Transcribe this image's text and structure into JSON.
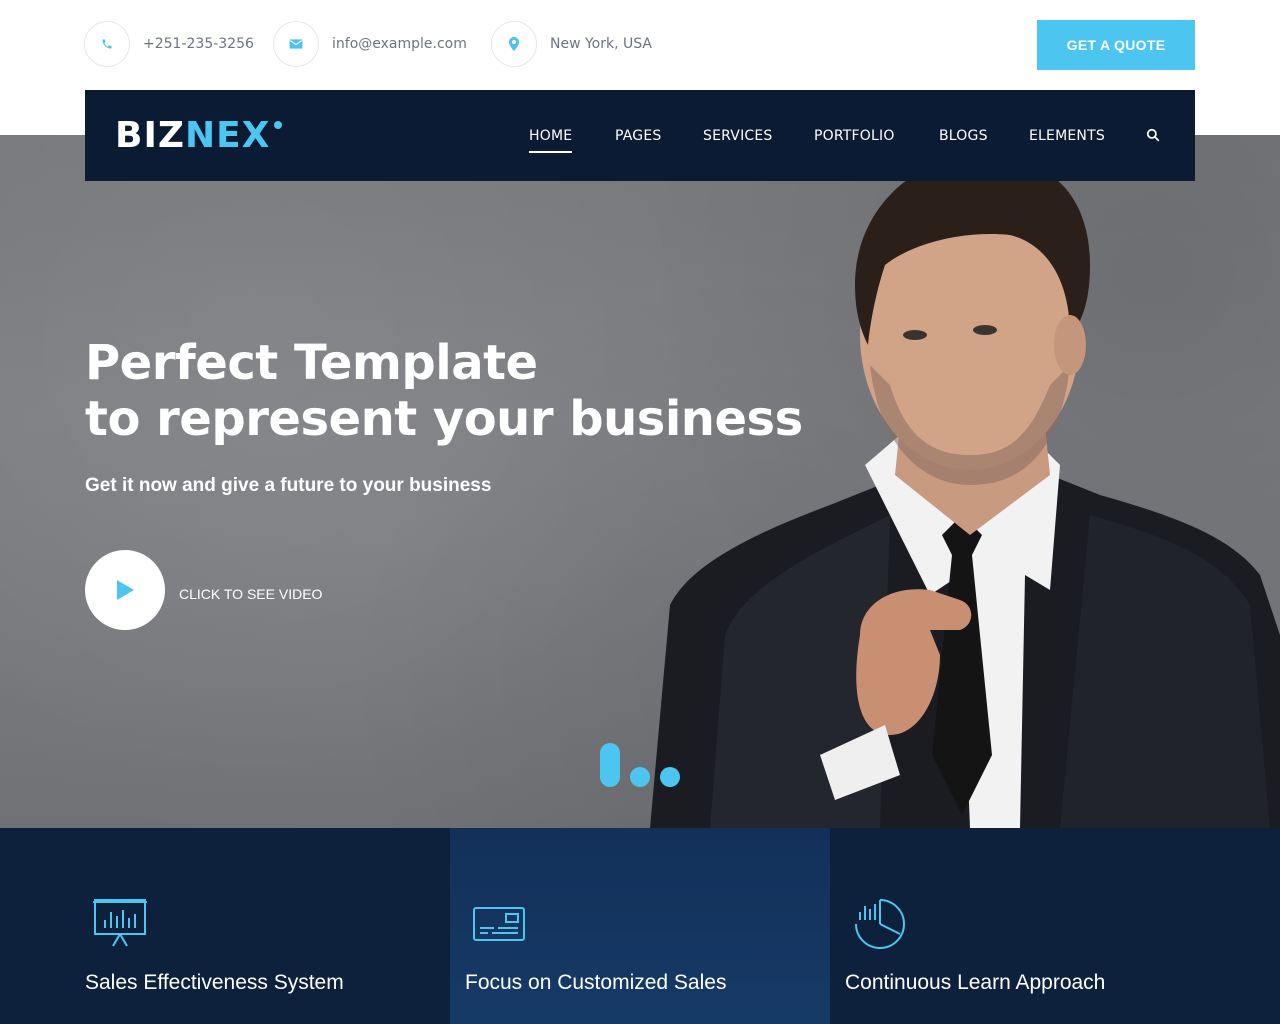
{
  "topbar": {
    "phone": "+251-235-3256",
    "email": "info@example.com",
    "location": "New York, USA",
    "quote_label": "GET A QUOTE"
  },
  "nav": {
    "logo_part1": "BIZ",
    "logo_part2": "NEX",
    "items": [
      {
        "label": "HOME",
        "active": true
      },
      {
        "label": "PAGES"
      },
      {
        "label": "SERVICES"
      },
      {
        "label": "PORTFOLIO"
      },
      {
        "label": "BLOGS"
      },
      {
        "label": "ELEMENTS"
      }
    ],
    "search_icon": "search-icon"
  },
  "hero": {
    "title_line1": "Perfect Template",
    "title_line2": "to represent your business",
    "subtitle": "Get it now and give a future to your business",
    "video_label": "CLICK TO SEE VIDEO",
    "slides": 3,
    "active_slide": 1
  },
  "features": [
    {
      "title": "Sales Effectiveness System",
      "icon": "presentation-chart-icon"
    },
    {
      "title": "Focus on Customized Sales",
      "icon": "credit-card-icon"
    },
    {
      "title": "Continuous Learn Approach",
      "icon": "pie-chart-icon"
    }
  ],
  "colors": {
    "accent": "#4cc6f1",
    "navy": "#0c1b34",
    "white": "#ffffff"
  }
}
